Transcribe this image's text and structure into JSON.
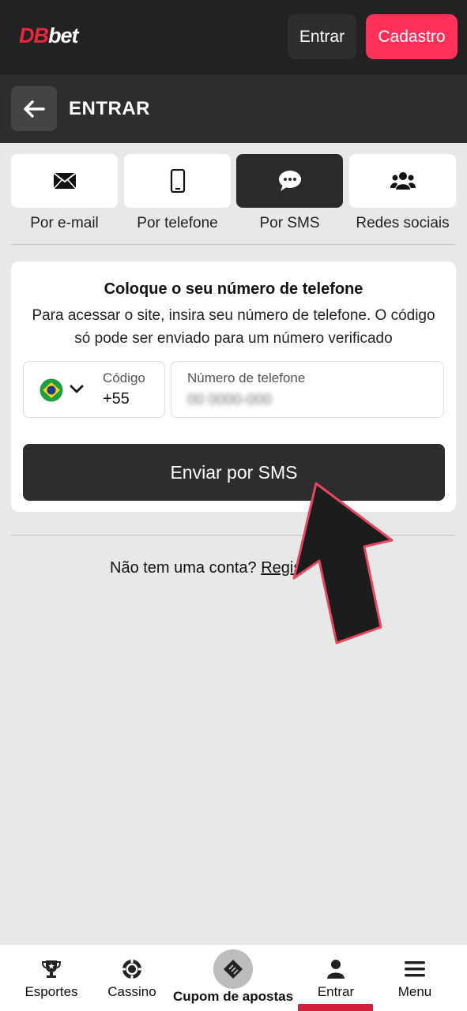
{
  "header": {
    "logo_db": "DB",
    "logo_bet": "bet",
    "enter_label": "Entrar",
    "register_label": "Cadastro"
  },
  "subheader": {
    "title": "ENTRAR",
    "back_icon": "arrow-left-icon"
  },
  "tabs": [
    {
      "label": "Por e-mail",
      "icon": "envelope-icon",
      "active": false
    },
    {
      "label": "Por telefone",
      "icon": "phone-icon",
      "active": false
    },
    {
      "label": "Por SMS",
      "icon": "chat-bubble-icon",
      "active": true
    },
    {
      "label": "Redes sociais",
      "icon": "users-icon",
      "active": false
    }
  ],
  "form": {
    "title": "Coloque o seu número de telefone",
    "description": "Para acessar o site, insira seu número de telefone. O código só pode ser enviado para um número verificado",
    "code_label": "Código",
    "code_value": "+55",
    "country_flag": "brazil-flag-icon",
    "phone_label": "Número de telefone",
    "phone_placeholder": "00 0000-000",
    "submit_label": "Enviar por SMS"
  },
  "footer_text": {
    "question": "Não tem uma conta? ",
    "link": "Regis"
  },
  "bottom_nav": {
    "items": [
      {
        "label": "Esportes",
        "icon": "trophy-icon"
      },
      {
        "label": "Cassino",
        "icon": "casino-chip-icon"
      },
      {
        "label": "Cupom de apostas",
        "icon": "ticket-icon"
      },
      {
        "label": "Entrar",
        "icon": "user-icon",
        "active": true
      },
      {
        "label": "Menu",
        "icon": "hamburger-icon"
      }
    ]
  },
  "colors": {
    "brand_red": "#ff3158",
    "dark": "#222222",
    "active_tab": "#2a2a2a",
    "nav_active": "#d21f3c"
  }
}
